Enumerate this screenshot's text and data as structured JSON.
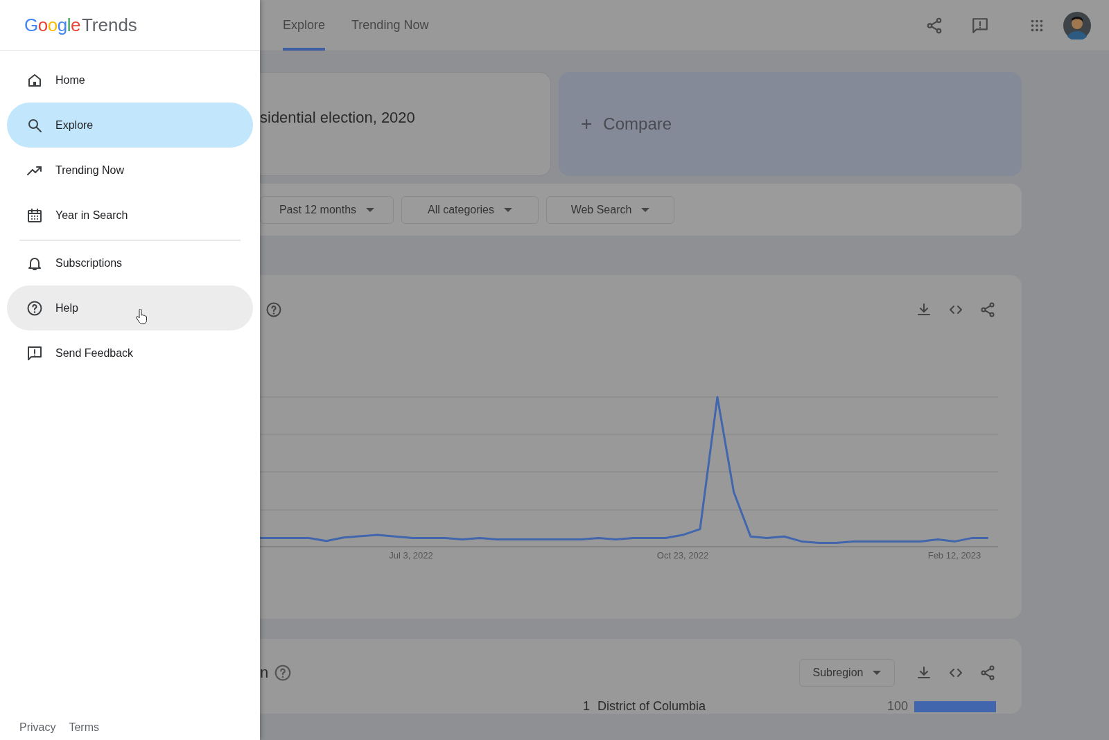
{
  "drawer": {
    "logo": {
      "brand": "Google",
      "product": "Trends"
    },
    "items": [
      {
        "label": "Home",
        "selected": false,
        "hovered": false,
        "divider_before": false
      },
      {
        "label": "Explore",
        "selected": true,
        "hovered": false,
        "divider_before": false
      },
      {
        "label": "Trending Now",
        "selected": false,
        "hovered": false,
        "divider_before": false
      },
      {
        "label": "Year in Search",
        "selected": false,
        "hovered": false,
        "divider_before": false
      },
      {
        "label": "Subscriptions",
        "selected": false,
        "hovered": false,
        "divider_before": true
      },
      {
        "label": "Help",
        "selected": false,
        "hovered": true,
        "divider_before": false
      },
      {
        "label": "Send Feedback",
        "selected": false,
        "hovered": false,
        "divider_before": false
      }
    ],
    "footer_links": [
      "Privacy",
      "Terms"
    ]
  },
  "header": {
    "tabs": [
      {
        "label": "Explore",
        "selected": true
      },
      {
        "label": "Trending Now",
        "selected": false
      }
    ]
  },
  "search_term": "sidential election, 2020",
  "compare": {
    "icon": "+",
    "label": "Compare"
  },
  "filters": [
    "Past 12 months",
    "All categories",
    "Web Search"
  ],
  "interest_chart": {
    "x_labels": [
      "Jul 3, 2022",
      "Oct 23, 2022",
      "Feb 12, 2023"
    ]
  },
  "region_card": {
    "title": "n",
    "dropdown": "Subregion",
    "rows": [
      {
        "rank": "1",
        "name": "District of Columbia",
        "value": "100",
        "level": 1
      }
    ]
  }
}
